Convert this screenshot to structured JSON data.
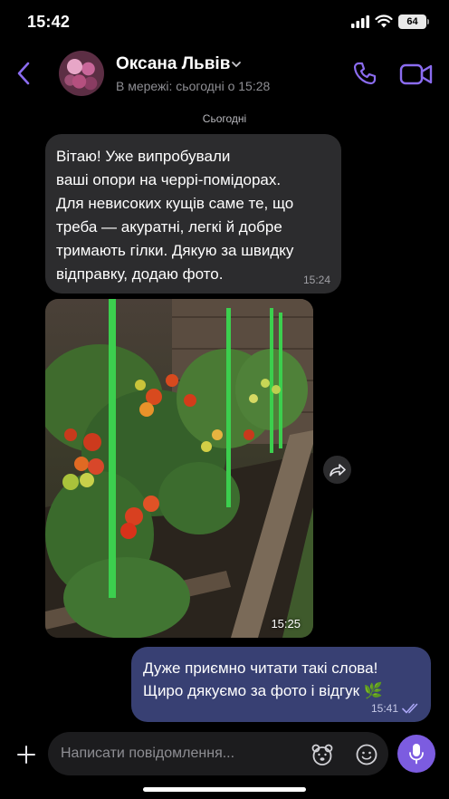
{
  "status_bar": {
    "time": "15:42",
    "battery": "64"
  },
  "header": {
    "contact_name": "Оксана Львів",
    "contact_status": "В мережі: сьогодні о 15:28"
  },
  "chat": {
    "date_divider": "Сьогодні",
    "messages": [
      {
        "direction": "incoming",
        "type": "text",
        "lines": [
          "Вітаю! Уже випробували",
          "ваші опори на черрі-помідорах.",
          "Для невисоких кущів саме те, що",
          "треба — акуратні, легкі й добре",
          "тримають гілки. Дякую за швидку",
          "відправку, додаю фото."
        ],
        "time": "15:24"
      },
      {
        "direction": "incoming",
        "type": "photo",
        "time": "15:25"
      },
      {
        "direction": "outgoing",
        "type": "text",
        "lines": [
          "Дуже приємно читати такі слова!",
          "Щиро дякуємо за фото і відгук 🌿"
        ],
        "time": "15:41",
        "read": true
      }
    ]
  },
  "composer": {
    "placeholder": "Написати повідомлення..."
  },
  "colors": {
    "accent": "#7c5ce0",
    "outgoing_bubble": "#384073",
    "incoming_bubble": "#2c2c2e",
    "background": "#000000"
  },
  "icons": [
    "chevron-left-icon",
    "chevron-down-icon",
    "phone-icon",
    "video-camera-icon",
    "forward-icon",
    "read-ticks-icon",
    "plus-icon",
    "sticker-bear-icon",
    "emoji-icon",
    "microphone-icon"
  ]
}
